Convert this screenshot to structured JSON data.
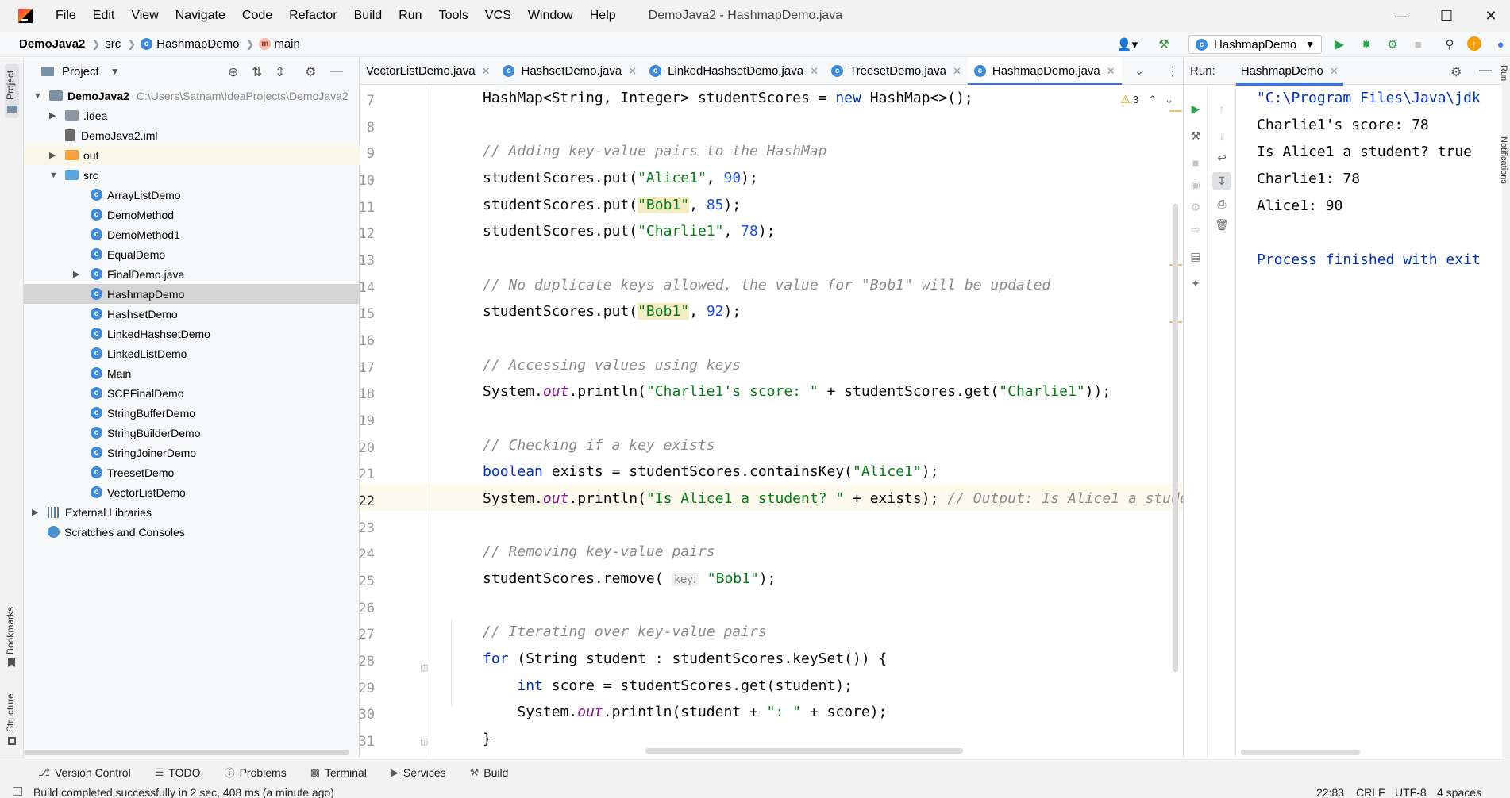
{
  "app": {
    "window_title": "DemoJava2 - HashmapDemo.java",
    "menu": [
      "File",
      "Edit",
      "View",
      "Navigate",
      "Code",
      "Refactor",
      "Build",
      "Run",
      "Tools",
      "VCS",
      "Window",
      "Help"
    ]
  },
  "breadcrumb": {
    "project": "DemoJava2",
    "folder": "src",
    "class": "HashmapDemo",
    "method": "main"
  },
  "toolbar": {
    "run_config": "HashmapDemo"
  },
  "project_panel": {
    "title": "Project",
    "root": {
      "name": "DemoJava2",
      "path": "C:\\Users\\Satnam\\IdeaProjects\\DemoJava2"
    },
    "idea": ".idea",
    "iml": "DemoJava2.iml",
    "out": "out",
    "src": "src",
    "classes": [
      "ArrayListDemo",
      "DemoMethod",
      "DemoMethod1",
      "EqualDemo",
      "FinalDemo.java",
      "HashmapDemo",
      "HashsetDemo",
      "LinkedHashsetDemo",
      "LinkedListDemo",
      "Main",
      "SCPFinalDemo",
      "StringBufferDemo",
      "StringBuilderDemo",
      "StringJoinerDemo",
      "TreesetDemo",
      "VectorListDemo"
    ],
    "selected": "HashmapDemo",
    "external_libraries": "External Libraries",
    "scratches": "Scratches and Consoles"
  },
  "left_strip": {
    "project": "Project",
    "bookmarks": "Bookmarks",
    "structure": "Structure"
  },
  "editor": {
    "tabs": [
      "VectorListDemo.java",
      "HashsetDemo.java",
      "LinkedHashsetDemo.java",
      "TreesetDemo.java",
      "HashmapDemo.java"
    ],
    "active_tab": "HashmapDemo.java",
    "warnings": "3",
    "line_numbers": [
      "7",
      "8",
      "9",
      "10",
      "11",
      "12",
      "13",
      "14",
      "15",
      "16",
      "17",
      "18",
      "19",
      "20",
      "21",
      "22",
      "23",
      "24",
      "25",
      "26",
      "27",
      "28",
      "29",
      "30",
      "31"
    ],
    "current_line": "22",
    "hint_key": "key:"
  },
  "run_panel": {
    "label": "Run:",
    "tab": "HashmapDemo",
    "output": [
      "\"C:\\Program Files\\Java\\jdk",
      "Charlie1's score: 78",
      "Is Alice1 a student? true",
      "Charlie1: 78",
      "Alice1: 90",
      "",
      "Process finished with exit"
    ],
    "right_strip": "Notifications",
    "right_strip_run": "Run"
  },
  "bottom_bar": {
    "items": [
      "Version Control",
      "TODO",
      "Problems",
      "Terminal",
      "Services",
      "Build"
    ]
  },
  "status_bar": {
    "message": "Build completed successfully in 2 sec, 408 ms (a minute ago)",
    "position": "22:83",
    "line_sep": "CRLF",
    "encoding": "UTF-8",
    "indent": "4 spaces"
  },
  "colors": {
    "keyword": "#0033b3",
    "string": "#067d17",
    "number": "#1750eb",
    "comment": "#8c8c8c",
    "field": "#871094",
    "accent": "#3574f0",
    "run_green": "#2ca24c"
  }
}
